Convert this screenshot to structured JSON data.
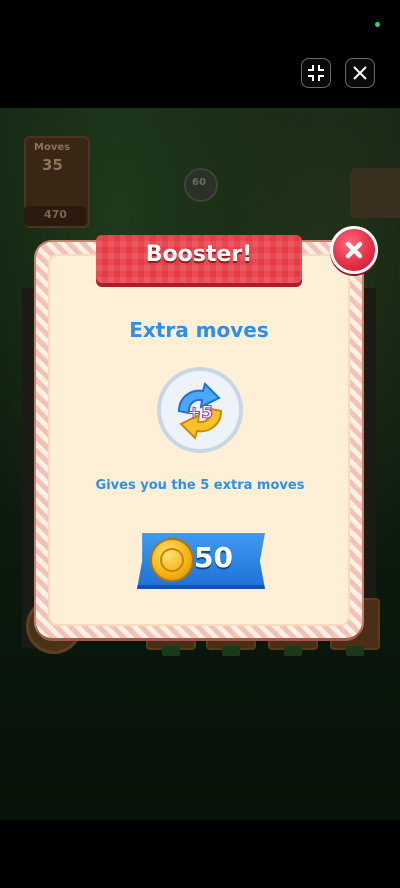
{
  "topbar": {
    "exit_fullscreen_icon": "compress-icon",
    "close_icon": "x-icon"
  },
  "background": {
    "moves_label": "Moves",
    "moves_value": "35",
    "score_value": "470",
    "target_value": "60"
  },
  "dialog": {
    "title": "Booster!",
    "booster_name": "Extra moves",
    "icon_badge": "+5",
    "description": "Gives you the 5 extra moves",
    "price": "50",
    "price_icon": "coin-icon",
    "close_icon": "x-icon"
  },
  "colors": {
    "title_ribbon": "#e63b45",
    "accent_blue": "#2f8fe6",
    "panel_bg": "#fdf0d6",
    "coin": "#f4b614"
  }
}
